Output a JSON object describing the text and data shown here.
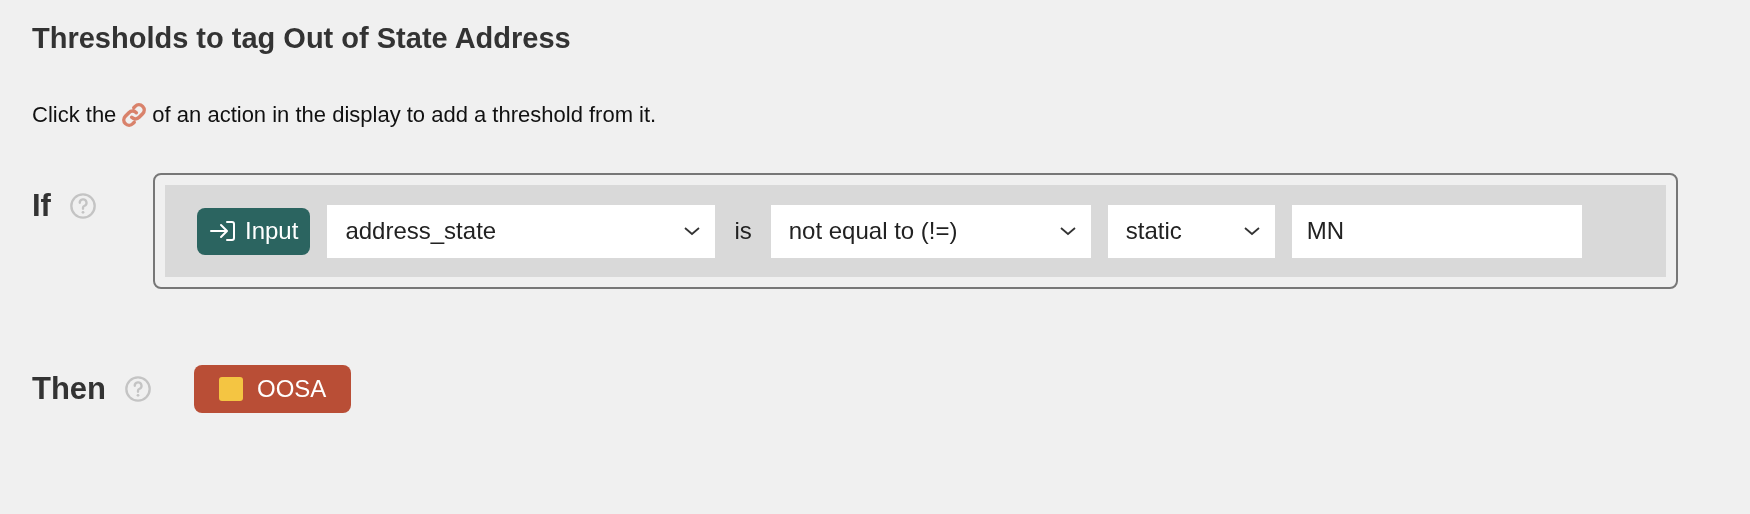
{
  "title": "Thresholds to tag Out of State Address",
  "instruction": {
    "before": "Click the",
    "after": "of an action in the display to add a threshold from it."
  },
  "if_section": {
    "label": "If",
    "condition": {
      "source": "Input",
      "field": "address_state",
      "connector": "is",
      "operator": "not equal to (!=)",
      "value_type": "static",
      "value": "MN"
    }
  },
  "then_section": {
    "label": "Then",
    "tags": [
      {
        "name": "OOSA",
        "color": "#f4c542"
      }
    ]
  }
}
